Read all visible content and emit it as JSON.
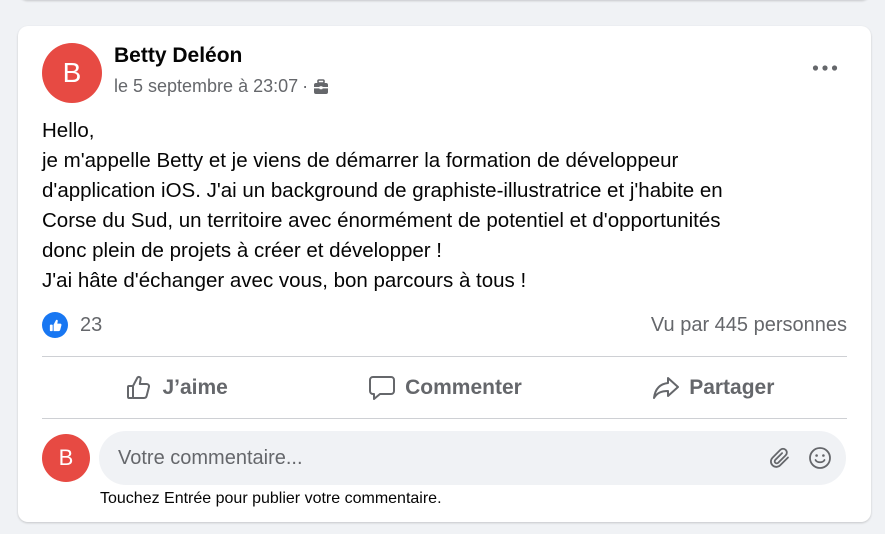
{
  "post": {
    "author": "Betty Deléon",
    "avatar_initial": "B",
    "date": "le 5 septembre à 23:07",
    "separator": "·",
    "audience_icon": "briefcase-icon",
    "menu_icon": "more-options-icon",
    "text_lines": [
      "Hello,",
      "je m'appelle Betty et je viens de démarrer la formation de développeur",
      "d'application iOS. J'ai un background de graphiste-illustratrice et j'habite en",
      "Corse du Sud, un territoire avec énormément de potentiel et d'opportunités",
      "donc plein de projets à créer et développer !",
      "J'ai hâte d'échanger avec vous, bon parcours à tous !"
    ]
  },
  "stats": {
    "like_count": "23",
    "views": "Vu par 445 personnes"
  },
  "actions": {
    "like_label": "J’aime",
    "comment_label": "Commenter",
    "share_label": "Partager"
  },
  "comment": {
    "avatar_initial": "B",
    "placeholder": "Votre commentaire...",
    "hint": "Touchez Entrée pour publier votre commentaire."
  },
  "colors": {
    "avatar": "#e74a43",
    "like_badge": "#1877f2",
    "secondary_text": "#65676b"
  }
}
